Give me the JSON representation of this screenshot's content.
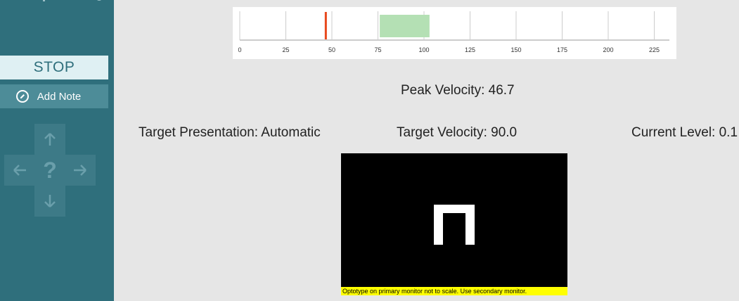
{
  "sidebar": {
    "top_icons": [
      "minus-icon",
      "home-icon",
      "pin-icon",
      "gear-icon"
    ],
    "stop_label": "STOP",
    "add_note_label": "Add Note",
    "dpad": {
      "up": "arrow-up-icon",
      "left": "arrow-left-icon",
      "center": "?",
      "right": "arrow-right-icon",
      "down": "arrow-down-icon"
    }
  },
  "chart_data": {
    "type": "bar",
    "x_ticks": [
      "0",
      "25",
      "50",
      "75",
      "100",
      "125",
      "150",
      "175",
      "200",
      "225"
    ],
    "xlim": [
      0,
      235
    ],
    "target_range": [
      76,
      103
    ],
    "peak_marker": 46.7,
    "colors": {
      "target_range": "#b4e0b4",
      "peak_marker": "#e8481c",
      "grid": "#cccccc"
    }
  },
  "status": {
    "peak_velocity": "Peak Velocity: 46.7",
    "target_presentation": "Target Presentation: Automatic",
    "target_velocity": "Target Velocity: 90.0",
    "current_level": "Current Level: 0.1"
  },
  "display": {
    "optotype": "П",
    "warning": "Optotype on primary monitor not to scale. Use secondary monitor."
  }
}
